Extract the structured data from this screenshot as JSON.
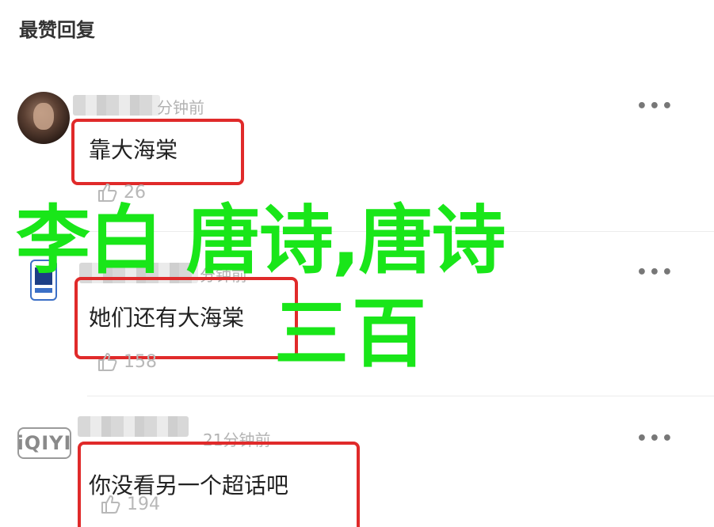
{
  "section": {
    "title": "最赞回复"
  },
  "comments": [
    {
      "timestamp": "分钟前",
      "text": "靠大海棠",
      "likes": "26"
    },
    {
      "timestamp": "分钟前",
      "text": "她们还有大海棠",
      "likes": "158"
    },
    {
      "avatar_label": "iQIYI",
      "timestamp": "21分钟前",
      "text": "你没看另一个超话吧",
      "likes": "194"
    }
  ],
  "more_label": "•••",
  "watermark": {
    "line1": "李白 唐诗,唐诗",
    "line2": "三百",
    "color": "#19e619"
  },
  "colors": {
    "highlight_box": "#e02a2a",
    "muted_text": "#b3b3b3"
  },
  "icons": {
    "more": "more-dots-icon",
    "like": "thumbs-up-icon"
  }
}
